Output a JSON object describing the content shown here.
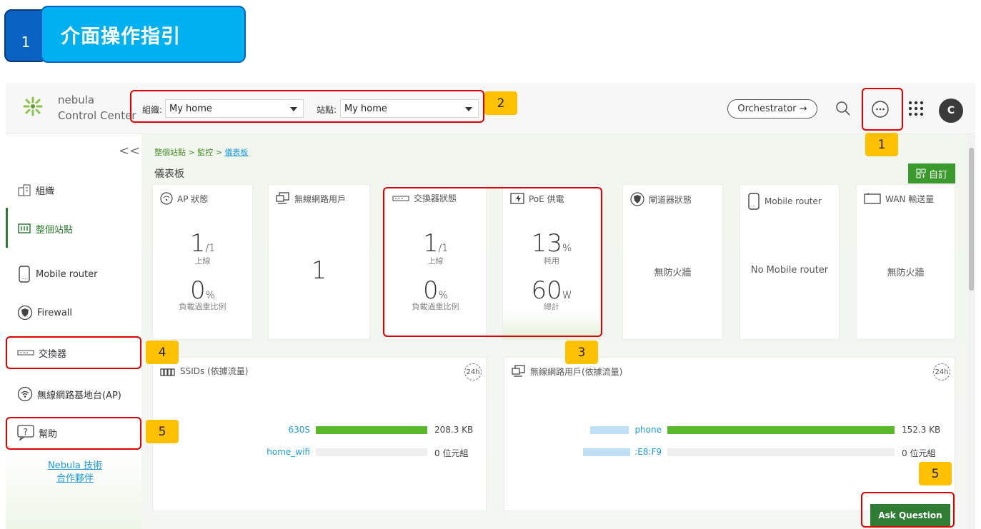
{
  "banner": {
    "number": "1",
    "title": "介面操作指引"
  },
  "topbar": {
    "logo_line1": "nebula",
    "logo_line2": "Control Center",
    "org_label": "組織:",
    "org_value": "My home",
    "site_label": "站點:",
    "site_value": "My home",
    "orchestrator_label": "Orchestrator →",
    "avatar_initial": "C"
  },
  "sidebar": {
    "collapse": "<<",
    "items": [
      {
        "label": "組織",
        "icon": "building-icon"
      },
      {
        "label": "整個站點",
        "icon": "site-icon"
      },
      {
        "label": "Mobile router",
        "icon": "mobile-router-icon"
      },
      {
        "label": "Firewall",
        "icon": "shield-icon"
      },
      {
        "label": "交換器",
        "icon": "switch-icon"
      },
      {
        "label": "無線網路基地台(AP)",
        "icon": "wifi-icon"
      },
      {
        "label": "幫助",
        "icon": "help-icon"
      }
    ],
    "footer_link1": "Nebula 技術",
    "footer_link2": "合作夥伴"
  },
  "main": {
    "breadcrumb_1": "整個站點",
    "breadcrumb_sep": " > ",
    "breadcrumb_2": "監控",
    "breadcrumb_3": "儀表板",
    "title": "儀表板",
    "customize_label": "自訂",
    "cards": {
      "ap": {
        "title": "AP 狀態",
        "online_num": "1",
        "online_den": "/1",
        "online_label": "上線",
        "load_num": "0",
        "load_unit": "%",
        "load_label": "負載過重比例"
      },
      "wireless_clients": {
        "title": "無線網路用戶",
        "value": "1"
      },
      "switch": {
        "title": "交換器狀態",
        "online_num": "1",
        "online_den": "/1",
        "online_label": "上線",
        "load_num": "0",
        "load_unit": "%",
        "load_label": "負載過重比例"
      },
      "poe": {
        "title": "PoE 供電",
        "usage_num": "13",
        "usage_unit": "%",
        "usage_label": "耗用",
        "total_num": "60",
        "total_unit": "W",
        "total_label": "總計"
      },
      "gateway": {
        "title": "閘道器狀態",
        "value": "無防火牆"
      },
      "mobile_router": {
        "title": "Mobile router",
        "value": "No Mobile router"
      },
      "wan": {
        "title": "WAN 輸送量",
        "value": "無防火牆"
      }
    },
    "ssid_panel": {
      "title": "SSIDs (依據流量)",
      "badge": "24h",
      "rows": [
        {
          "label": "630S",
          "value": "208.3 KB",
          "fill": 1.0
        },
        {
          "label": "home_wifi",
          "value": "0 位元組",
          "fill": 0.0
        }
      ]
    },
    "clients_panel": {
      "title": "無線網路用戶(依據流量)",
      "badge": "24h",
      "rows": [
        {
          "label": "phone",
          "value": "152.3 KB",
          "fill": 1.0
        },
        {
          "label": ":E8:F9",
          "value": "0 位元組",
          "fill": 0.0
        }
      ]
    },
    "ask_question": "Ask Question"
  },
  "annotations": {
    "tag_1": "1",
    "tag_2": "2",
    "tag_3": "3",
    "tag_4": "4",
    "tag_5a": "5",
    "tag_5b": "5"
  },
  "colors": {
    "accent_green": "#3a9b2c",
    "annotation_red": "#e00000",
    "tag_yellow": "#ffc000",
    "banner_blue": "#00b0f0"
  }
}
